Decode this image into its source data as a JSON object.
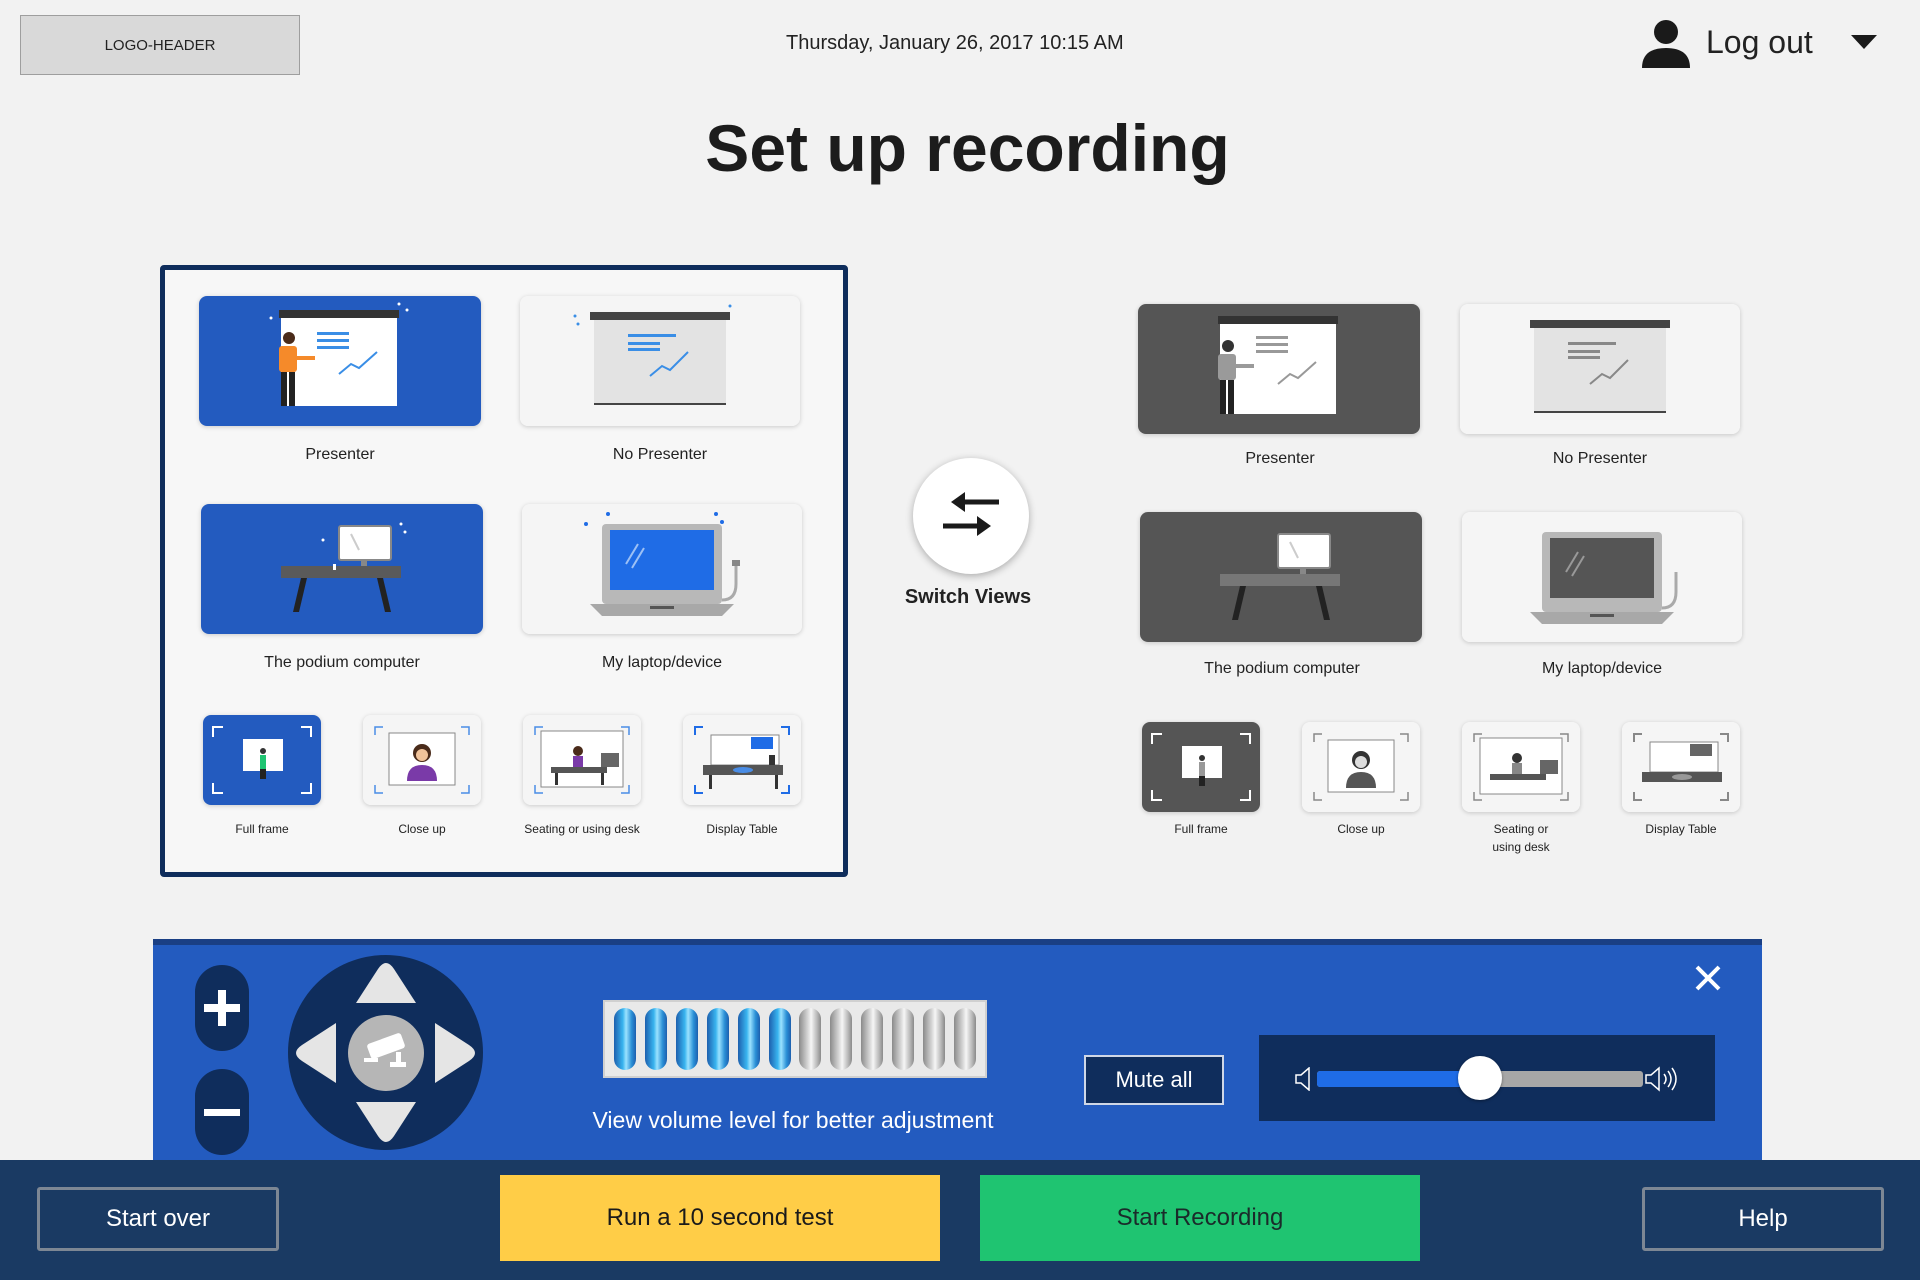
{
  "header": {
    "logo_text": "LOGO-HEADER",
    "datetime": "Thursday, January  26, 2017 10:15 AM",
    "logout_label": "Log out"
  },
  "page_title": "Set up recording",
  "selected_view": {
    "main_options": [
      {
        "label": "Presenter",
        "selected": true
      },
      {
        "label": "No Presenter",
        "selected": false
      },
      {
        "label": "The podium computer",
        "selected": true
      },
      {
        "label": "My laptop/device",
        "selected": false
      }
    ],
    "camera_options": [
      {
        "label": "Full frame",
        "selected": true
      },
      {
        "label": "Close up",
        "selected": false
      },
      {
        "label": "Seating or using desk",
        "selected": false
      },
      {
        "label": "Display Table",
        "selected": false
      }
    ]
  },
  "switch_views_label": "Switch Views",
  "alternate_view": {
    "main_options": [
      {
        "label": "Presenter",
        "selected": true
      },
      {
        "label": "No Presenter",
        "selected": false
      },
      {
        "label": "The podium computer",
        "selected": true
      },
      {
        "label": "My laptop/device",
        "selected": false
      }
    ],
    "camera_options": [
      {
        "label": "Full frame",
        "selected": true
      },
      {
        "label": "Close up",
        "selected": false
      },
      {
        "label": "Seating or\nusing desk",
        "selected": false
      },
      {
        "label": "Display Table",
        "selected": false
      }
    ]
  },
  "controls": {
    "volume_caption": "View volume level for better adjustment",
    "meter_active_bars": 6,
    "meter_total_bars": 12,
    "mute_label": "Mute all",
    "volume_level": 0.5
  },
  "footer": {
    "start_over": "Start over",
    "run_test": "Run a 10 second test",
    "start_recording": "Start Recording",
    "help": "Help"
  },
  "colors": {
    "selected_blue": "#235bbf",
    "selected_grey": "#555555",
    "navy": "#0f2d5c",
    "yellow": "#ffcd47",
    "green": "#1fc471"
  }
}
